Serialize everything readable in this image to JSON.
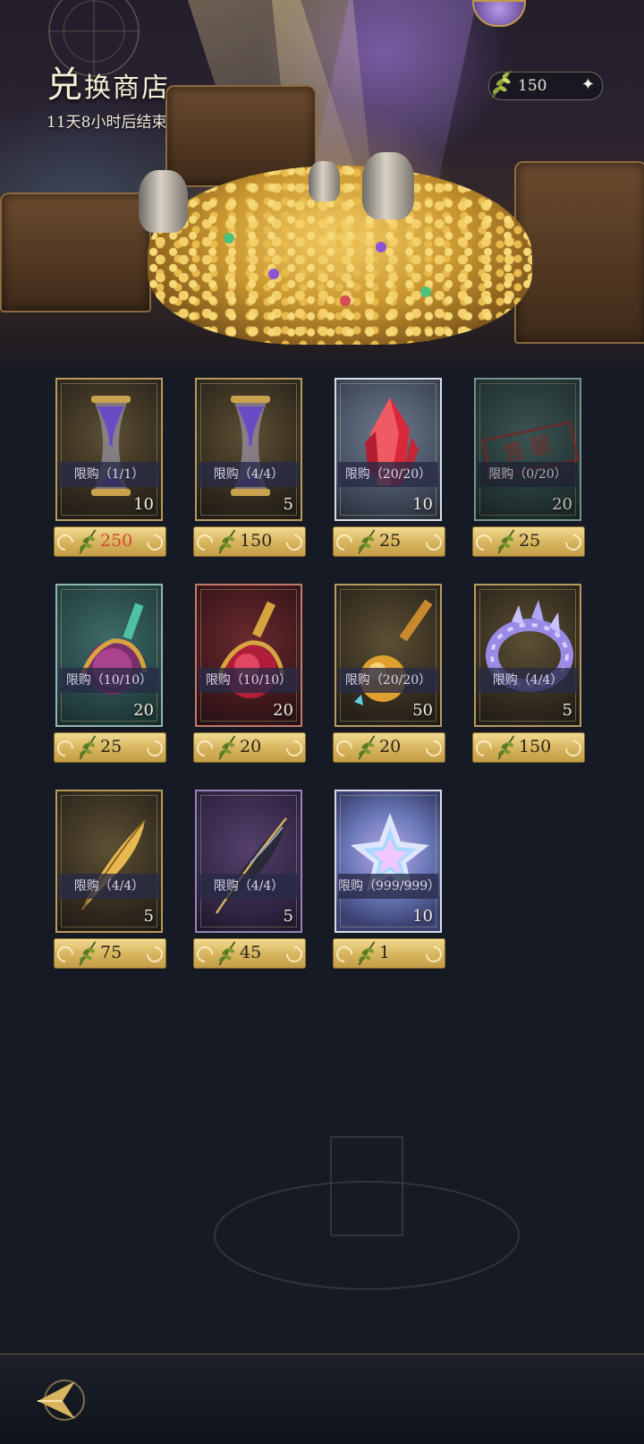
{
  "header": {
    "title_first": "兑",
    "title_rest": "换商店",
    "countdown": "11天8小时后结束"
  },
  "currency": {
    "amount": "150",
    "icon": "laurel-leaf-icon",
    "plus_icon": "sparkle-plus-icon"
  },
  "items": [
    {
      "name": "hourglass-purple",
      "limit": "限购（1/1）",
      "qty": "10",
      "price": "250",
      "price_red": true,
      "rarity": "gold"
    },
    {
      "name": "hourglass-purple",
      "limit": "限购（4/4）",
      "qty": "5",
      "price": "150",
      "price_red": false,
      "rarity": "gold"
    },
    {
      "name": "red-crystal",
      "limit": "限购（20/20）",
      "qty": "10",
      "price": "25",
      "price_red": false,
      "rarity": "silver"
    },
    {
      "name": "sold-out-item",
      "limit": "限购（0/20）",
      "qty": "20",
      "price": "25",
      "price_red": false,
      "rarity": "teal",
      "soldout_stamp": "售罄"
    },
    {
      "name": "teal-potion",
      "limit": "限购（10/10）",
      "qty": "20",
      "price": "25",
      "price_red": false,
      "rarity": "teal"
    },
    {
      "name": "red-potion",
      "limit": "限购（10/10）",
      "qty": "20",
      "price": "20",
      "price_red": false,
      "rarity": "red"
    },
    {
      "name": "amber-potion",
      "limit": "限购（20/20）",
      "qty": "50",
      "price": "20",
      "price_red": false,
      "rarity": "gold"
    },
    {
      "name": "crystal-ring",
      "limit": "限购（4/4）",
      "qty": "5",
      "price": "150",
      "price_red": false,
      "rarity": "gold"
    },
    {
      "name": "golden-feather",
      "limit": "限购（4/4）",
      "qty": "5",
      "price": "75",
      "price_red": false,
      "rarity": "gold"
    },
    {
      "name": "dark-feather",
      "limit": "限购（4/4）",
      "qty": "5",
      "price": "45",
      "price_red": false,
      "rarity": "purple"
    },
    {
      "name": "prism-star",
      "limit": "限购（999/999）",
      "qty": "10",
      "price": "1",
      "price_red": false,
      "rarity": "silver"
    }
  ],
  "footer": {
    "back_icon": "back-arrow-icon"
  },
  "colors": {
    "price_red": "#d44531",
    "price_gold": "#d6b35c",
    "background": "#151a24"
  }
}
